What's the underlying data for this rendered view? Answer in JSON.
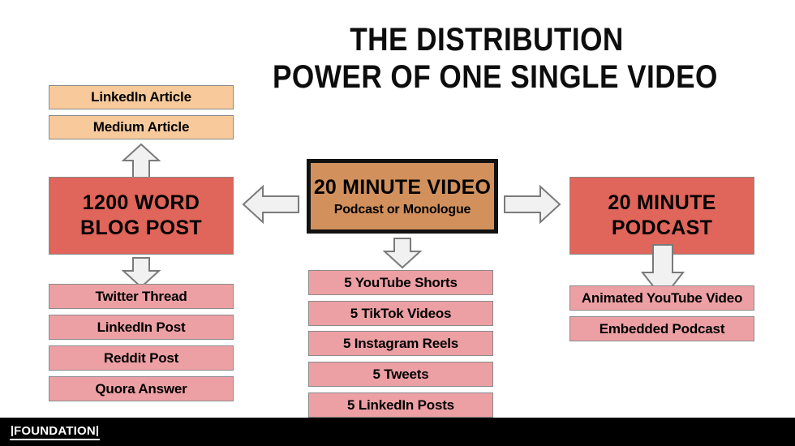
{
  "title": {
    "line1": "THE DISTRIBUTION",
    "line2": "POWER OF ONE SINGLE VIDEO"
  },
  "center": {
    "headline": "20 MINUTE VIDEO",
    "subline": "Podcast or Monologue"
  },
  "left_branch": {
    "hub": {
      "line1": "1200 WORD",
      "line2": "BLOG POST"
    },
    "upstream": [
      {
        "label": "LinkedIn Article"
      },
      {
        "label": "Medium Article"
      }
    ],
    "downstream": [
      {
        "label": "Twitter Thread"
      },
      {
        "label": "LinkedIn Post"
      },
      {
        "label": "Reddit Post"
      },
      {
        "label": "Quora Answer"
      }
    ]
  },
  "center_branch": {
    "downstream": [
      {
        "label": "5 YouTube Shorts"
      },
      {
        "label": "5 TikTok Videos"
      },
      {
        "label": "5 Instagram Reels"
      },
      {
        "label": "5 Tweets"
      },
      {
        "label": "5 LinkedIn Posts"
      }
    ]
  },
  "right_branch": {
    "hub": {
      "line1": "20 MINUTE",
      "line2": "PODCAST"
    },
    "downstream": [
      {
        "label": "Animated YouTube Video"
      },
      {
        "label": "Embedded Podcast"
      }
    ]
  },
  "footer": {
    "logo": "FOUNDATION"
  },
  "colors": {
    "hero_fill": "#d2915c",
    "hero_border": "#111111",
    "hub_fill": "#e0655a",
    "output_fill": "#eda0a4",
    "article_fill": "#f8ca9b",
    "box_border": "#8a8a8a",
    "arrow_fill": "#f1f1f1",
    "arrow_stroke": "#7a7a7a",
    "background": "#ffffff",
    "footer_bg": "#000000",
    "text": "#000000"
  }
}
